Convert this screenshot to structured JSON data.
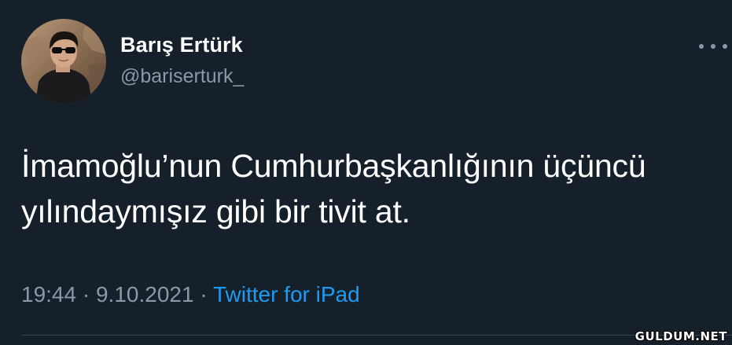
{
  "tweet": {
    "author": {
      "display_name": "Barış Ertürk",
      "handle": "@bariserturk_",
      "avatar": "profile-photo"
    },
    "text": "İmamoğlu’nun Cumhurbaşkanlığının üçüncü\nyılındaymışız gibi bir tivit at.",
    "time": "19:44",
    "separator": "·",
    "date": "9.10.2021",
    "source": "Twitter for iPad",
    "more_icon": "more-horizontal-icon"
  },
  "colors": {
    "background": "#15202b",
    "primary_text": "#ffffff",
    "secondary_text": "#8b98a5",
    "link": "#1d9bf0",
    "divider": "#38444d"
  },
  "watermark": "GULDUM.NET"
}
